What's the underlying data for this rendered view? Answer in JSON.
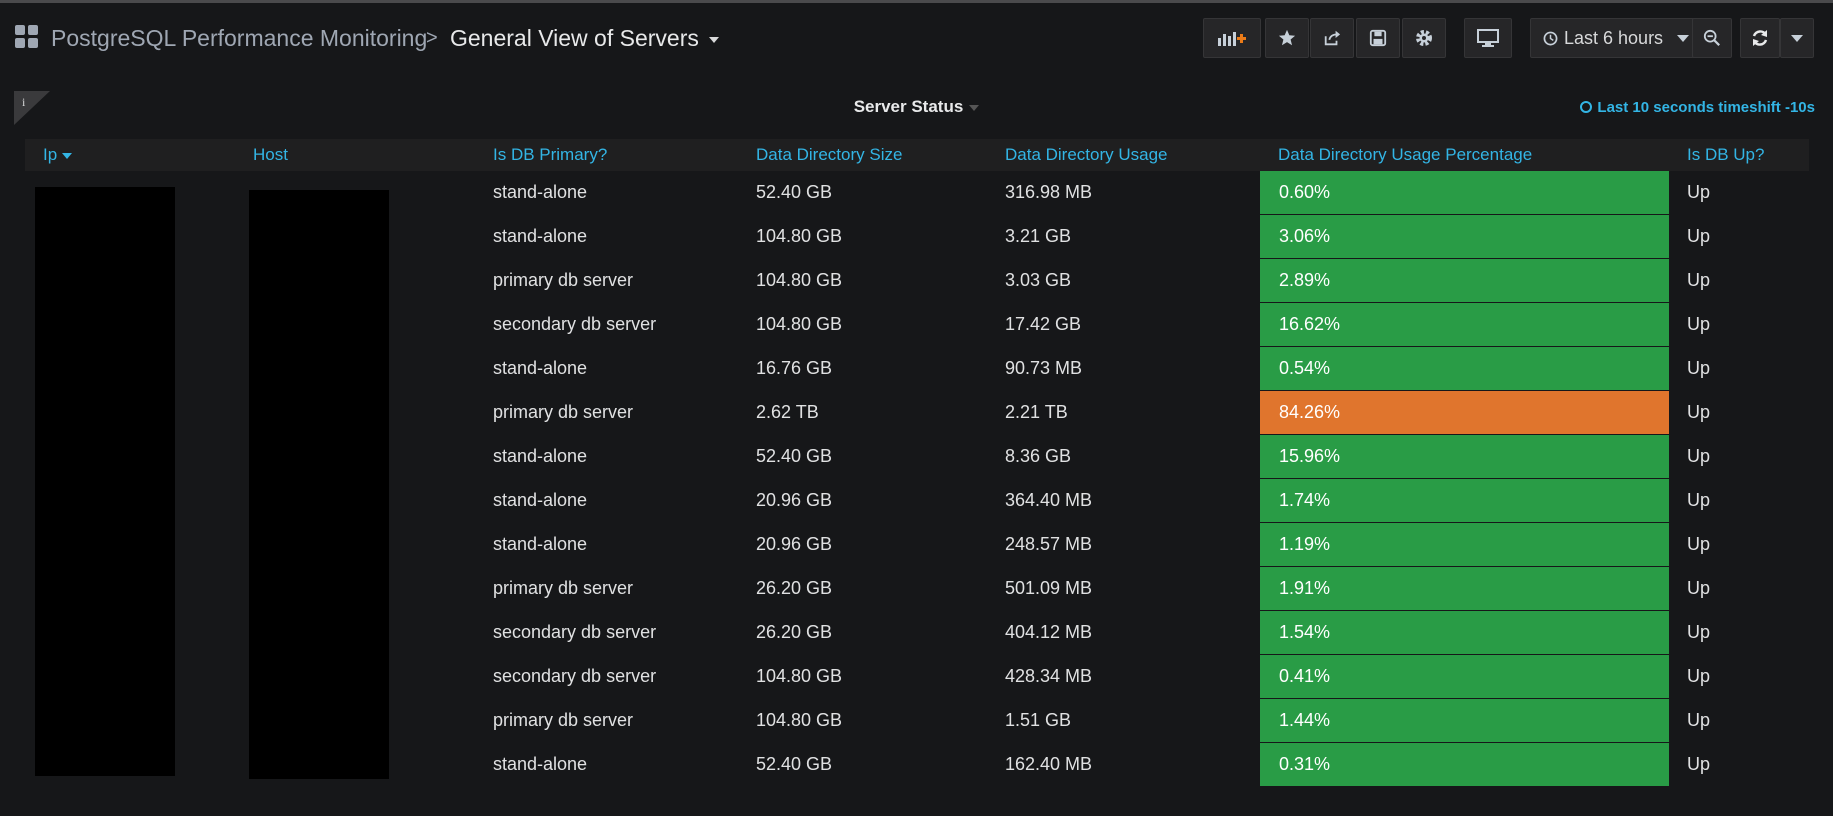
{
  "header": {
    "folder": "PostgreSQL Performance Monitoring",
    "separator": ">",
    "dashboard_title": "General View of Servers",
    "time_range": "Last 6 hours"
  },
  "panel": {
    "title": "Server Status",
    "info_glyph": "i",
    "timeshift": "Last 10 seconds timeshift -10s"
  },
  "colors": {
    "ok": "#299c46",
    "warning": "#e0752d",
    "link": "#33b5e5"
  },
  "table": {
    "columns": [
      "Ip",
      "Host",
      "Is DB Primary?",
      "Data Directory Size",
      "Data Directory Usage",
      "Data Directory Usage Percentage",
      "Is DB Up?"
    ],
    "rows": [
      {
        "primary": "stand-alone",
        "size": "52.40 GB",
        "usage": "316.98 MB",
        "pct": "0.60%",
        "pct_value": 0.6,
        "up": "Up"
      },
      {
        "primary": "stand-alone",
        "size": "104.80 GB",
        "usage": "3.21 GB",
        "pct": "3.06%",
        "pct_value": 3.06,
        "up": "Up"
      },
      {
        "primary": "primary db server",
        "size": "104.80 GB",
        "usage": "3.03 GB",
        "pct": "2.89%",
        "pct_value": 2.89,
        "up": "Up"
      },
      {
        "primary": "secondary db server",
        "size": "104.80 GB",
        "usage": "17.42 GB",
        "pct": "16.62%",
        "pct_value": 16.62,
        "up": "Up"
      },
      {
        "primary": "stand-alone",
        "size": "16.76 GB",
        "usage": "90.73 MB",
        "pct": "0.54%",
        "pct_value": 0.54,
        "up": "Up"
      },
      {
        "primary": "primary db server",
        "size": "2.62 TB",
        "usage": "2.21 TB",
        "pct": "84.26%",
        "pct_value": 84.26,
        "up": "Up"
      },
      {
        "primary": "stand-alone",
        "size": "52.40 GB",
        "usage": "8.36 GB",
        "pct": "15.96%",
        "pct_value": 15.96,
        "up": "Up"
      },
      {
        "primary": "stand-alone",
        "size": "20.96 GB",
        "usage": "364.40 MB",
        "pct": "1.74%",
        "pct_value": 1.74,
        "up": "Up"
      },
      {
        "primary": "stand-alone",
        "size": "20.96 GB",
        "usage": "248.57 MB",
        "pct": "1.19%",
        "pct_value": 1.19,
        "up": "Up"
      },
      {
        "primary": "primary db server",
        "size": "26.20 GB",
        "usage": "501.09 MB",
        "pct": "1.91%",
        "pct_value": 1.91,
        "up": "Up"
      },
      {
        "primary": "secondary db server",
        "size": "26.20 GB",
        "usage": "404.12 MB",
        "pct": "1.54%",
        "pct_value": 1.54,
        "up": "Up"
      },
      {
        "primary": "secondary db server",
        "size": "104.80 GB",
        "usage": "428.34 MB",
        "pct": "0.41%",
        "pct_value": 0.41,
        "up": "Up"
      },
      {
        "primary": "primary db server",
        "size": "104.80 GB",
        "usage": "1.51 GB",
        "pct": "1.44%",
        "pct_value": 1.44,
        "up": "Up"
      },
      {
        "primary": "stand-alone",
        "size": "52.40 GB",
        "usage": "162.40 MB",
        "pct": "0.31%",
        "pct_value": 0.31,
        "up": "Up"
      }
    ]
  }
}
